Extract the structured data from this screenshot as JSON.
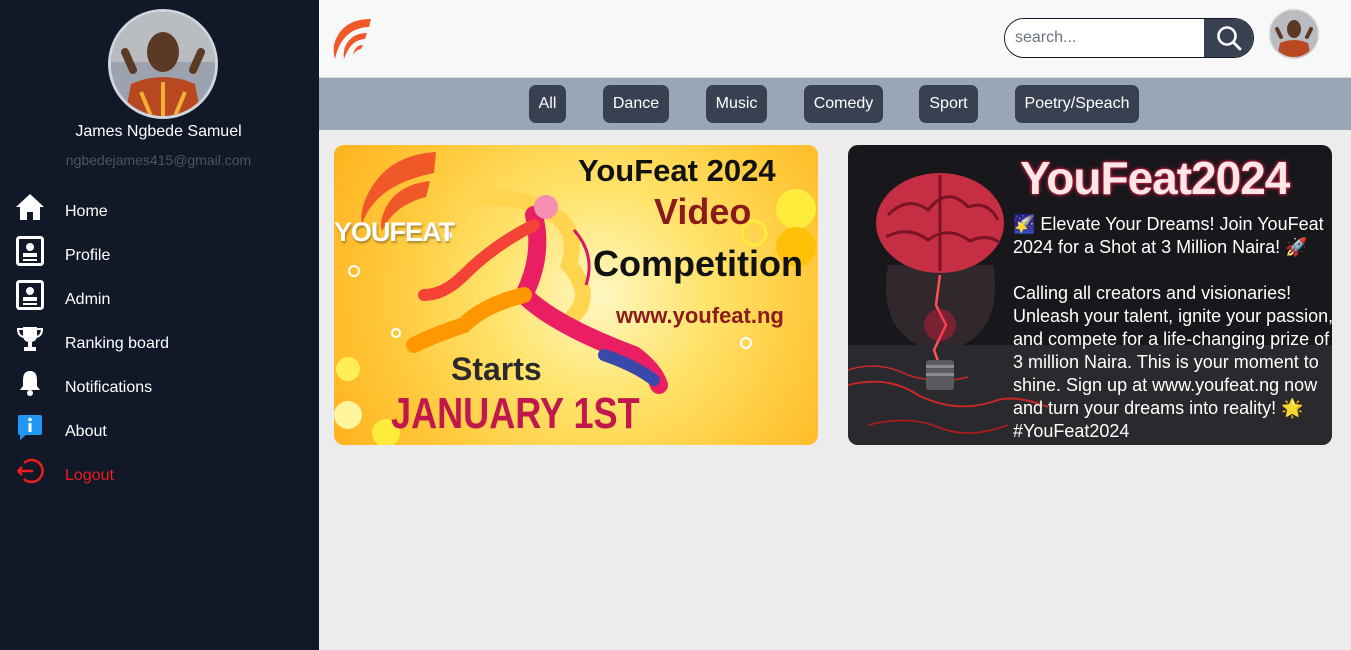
{
  "sidebar": {
    "user_name": "James Ngbede Samuel",
    "user_email": "ngbedejames415@gmail.com",
    "items": [
      {
        "label": "Home",
        "icon": "home-icon"
      },
      {
        "label": "Profile",
        "icon": "profile-card-icon"
      },
      {
        "label": "Admin",
        "icon": "admin-card-icon"
      },
      {
        "label": "Ranking board",
        "icon": "trophy-icon"
      },
      {
        "label": "Notifications",
        "icon": "bell-icon"
      },
      {
        "label": "About",
        "icon": "info-icon"
      },
      {
        "label": "Logout",
        "icon": "logout-icon"
      }
    ]
  },
  "header": {
    "logo": "youfeat-logo",
    "search_placeholder": "search...",
    "search_icon": "search-icon"
  },
  "categories": [
    "All",
    "Dance",
    "Music",
    "Comedy",
    "Sport",
    "Poetry/Speach"
  ],
  "cards": [
    {
      "brand": "YOUFEAT",
      "title": "YouFeat 2024",
      "line2": "Video",
      "line3": "Competition",
      "url": "www.youfeat.ng",
      "starts": "Starts",
      "date": "JANUARY 1ST"
    },
    {
      "title": "YouFeat2024",
      "text": "🌠 Elevate Your Dreams! Join YouFeat 2024 for a Shot at 3 Million Naira! 🚀\n\nCalling all creators and visionaries! Unleash your talent, ignite your passion, and compete for a life-changing prize of 3 million Naira. This is your moment to shine. Sign up at www.youfeat.ng now and turn your dreams into reality! 🌟 #YouFeat2024"
    }
  ],
  "colors": {
    "sidebar_bg": "#111827",
    "chip_bg": "#374151",
    "catbar_bg": "#9aa5b5",
    "logout": "#ef1d1d",
    "brand_orange": "#f0582a"
  }
}
